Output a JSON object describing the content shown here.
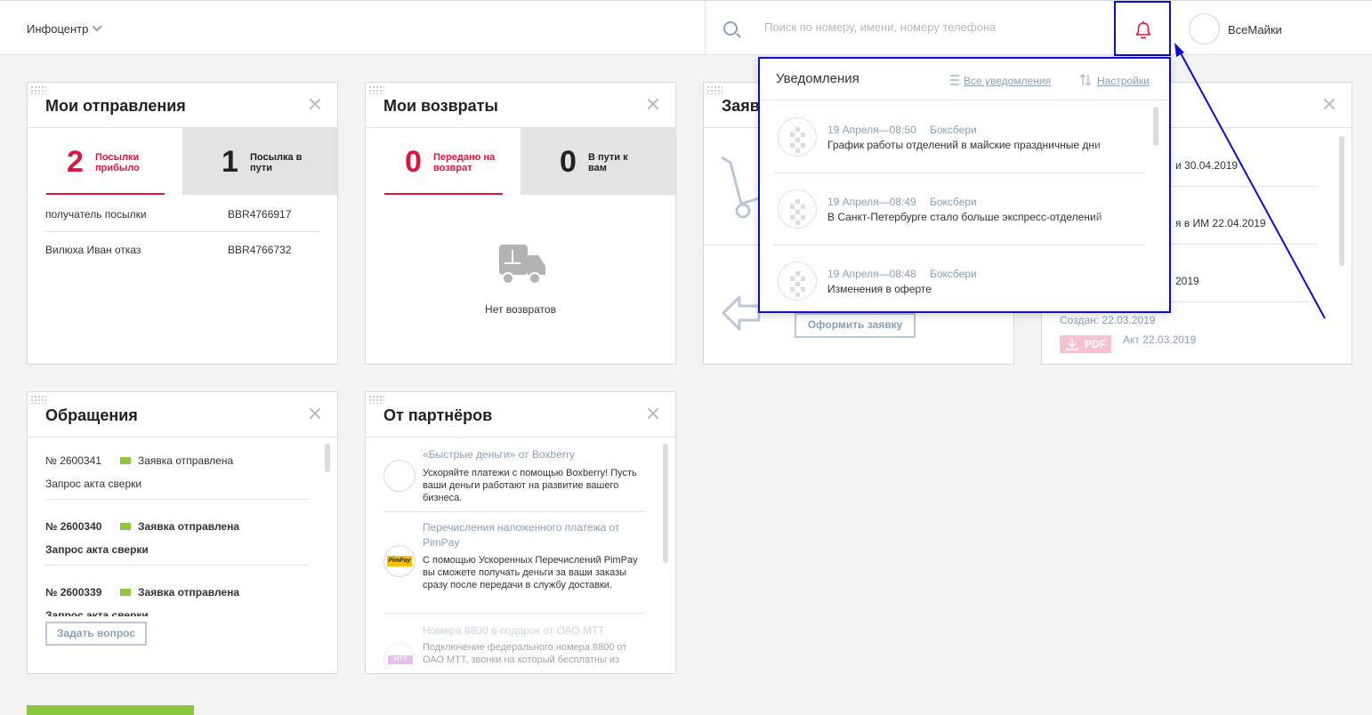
{
  "header": {
    "infocenter_label": "Инфоцентр",
    "search_placeholder": "Поиск по номеру, имени, номеру телефона",
    "user_name": "ВсеМайки"
  },
  "my_shipments": {
    "title": "Мои отправления",
    "stat_arrived_num": "2",
    "stat_arrived_label": "Посылки прибыло",
    "stat_transit_num": "1",
    "stat_transit_label": "Посылка в пути",
    "rows": [
      {
        "name": "получатель посылки",
        "code": "BBR4766917"
      },
      {
        "name": "Вилюха Иван отказ",
        "code": "BBR4766732"
      }
    ]
  },
  "my_returns": {
    "title": "Мои возвраты",
    "stat_sent_num": "0",
    "stat_sent_label": "Передано на возврат",
    "stat_transit_num": "0",
    "stat_transit_label": "В пути к вам",
    "empty_text": "Нет возвратов"
  },
  "requests_card": {
    "title": "Заяв",
    "button_label": "Оформить заявку"
  },
  "docs_card": {
    "line1": "и 30.04.2019",
    "line2": "я в ИМ 22.04.2019",
    "line3": "2019",
    "created": "Создан: 22.03.2019",
    "pdf_label": "PDF",
    "act": "Акт 22.03.2019"
  },
  "appeals": {
    "title": "Обращения",
    "tickets": [
      {
        "no": "№ 2600341",
        "status": "Заявка отправлена",
        "subject": "Запрос акта сверки"
      },
      {
        "no": "№ 2600340",
        "status": "Заявка отправлена",
        "subject": "Запрос акта сверки"
      },
      {
        "no": "№ 2600339",
        "status": "Заявка отправлена",
        "subject": "Запрос акта сверки"
      }
    ],
    "ask_button": "Задать вопрос"
  },
  "partners": {
    "title": "От партнёров",
    "items": [
      {
        "title": "«Быстрые деньги» от Boxberry",
        "text": "Ускоряйте платежи с помощью Boxberry! Пусть ваши деньги работают на развитие вашего бизнеса.",
        "logo": ""
      },
      {
        "title": "Перечисления наложенного платежа от PimPay",
        "text": "С помощью Ускоренных Перечислений PimPay вы сможете получать деньги за ваши заказы сразу после передачи в службу доставки.",
        "logo": "PimPay"
      },
      {
        "title": "Номера 8800 в подарок от ОАО МТТ",
        "text": "Подключение федерального номера 8800 от ОАО МТТ, звонки на который бесплатны из",
        "logo": "МТТ"
      }
    ]
  },
  "notifications": {
    "title": "Уведомления",
    "all_link": "Все уведомления",
    "settings_link": "Настройки",
    "items": [
      {
        "date": "19 Апреля—08:50",
        "source": "Боксбери",
        "text": "График работы отделений в майские праздничные дни"
      },
      {
        "date": "19 Апреля—08:49",
        "source": "Боксбери",
        "text": "В Санкт-Петербурге стало больше экспресс-отделений"
      },
      {
        "date": "19 Апреля—08:48",
        "source": "Боксбери",
        "text": "Изменения в оферте"
      }
    ]
  },
  "colors": {
    "accent_red": "#e0153f",
    "link_blue": "#8aa0bd",
    "highlight": "#0c0cd6",
    "green": "#8cc63f"
  }
}
